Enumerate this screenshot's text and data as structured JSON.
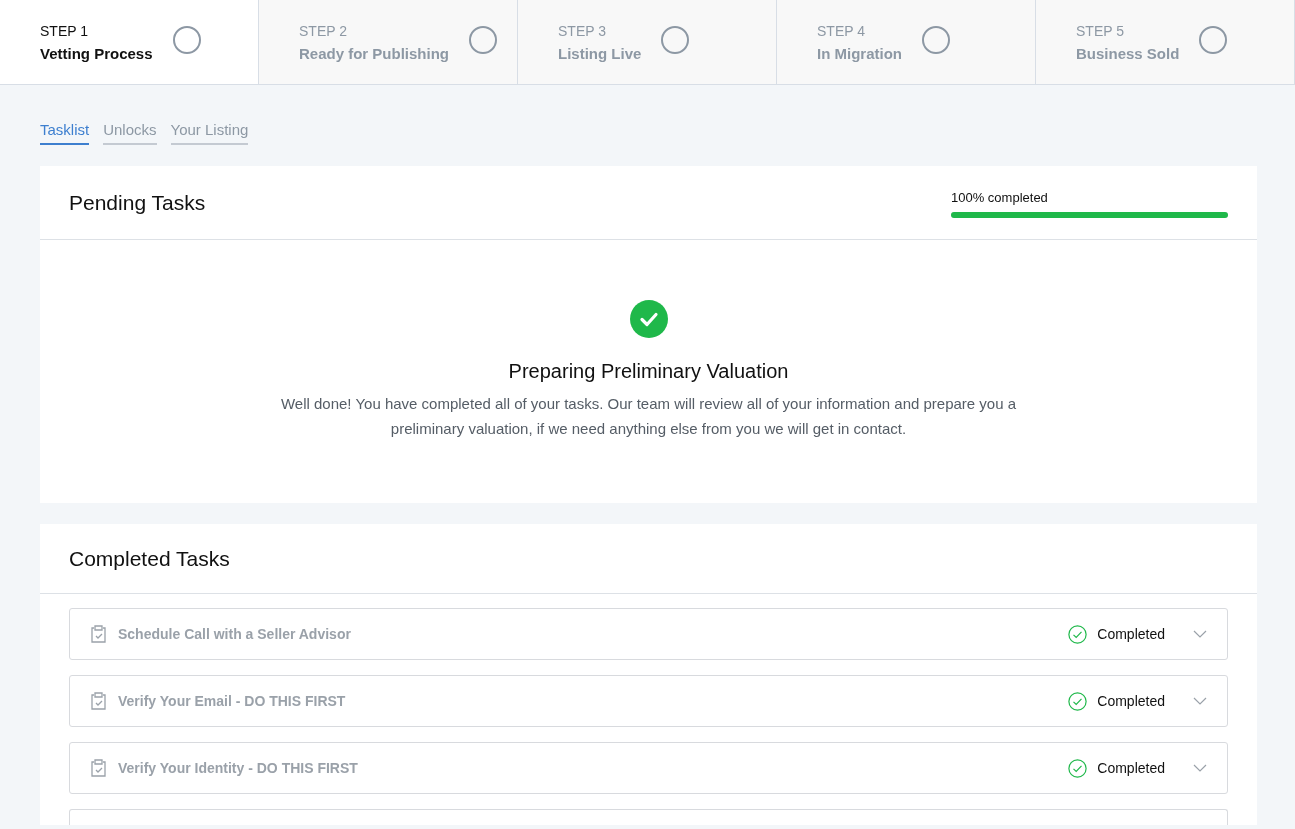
{
  "steps": [
    {
      "number": "STEP 1",
      "label": "Vetting Process",
      "selected": true,
      "done": false
    },
    {
      "number": "STEP 2",
      "label": "Ready for Publishing",
      "selected": false,
      "done": false
    },
    {
      "number": "STEP 3",
      "label": "Listing Live",
      "selected": false,
      "done": false
    },
    {
      "number": "STEP 4",
      "label": "In Migration",
      "selected": false,
      "done": false
    },
    {
      "number": "STEP 5",
      "label": "Business Sold",
      "selected": false,
      "done": false
    }
  ],
  "tabs": [
    {
      "label": "Tasklist",
      "selected": true
    },
    {
      "label": "Unlocks",
      "selected": false
    },
    {
      "label": "Your Listing",
      "selected": false
    }
  ],
  "pending": {
    "title": "Pending Tasks",
    "progress_label": "100% completed",
    "level": 1,
    "done_title": "Preparing Preliminary Valuation",
    "done_text": "Well done! You have completed all of your tasks. Our team will review all of your information and prepare you a preliminary valuation, if we need anything else from you we will get in contact."
  },
  "completed": {
    "title": "Completed Tasks",
    "tasks": [
      {
        "title": "Schedule Call with a Seller Advisor",
        "status": "Completed",
        "expanded": false
      },
      {
        "title": "Verify Your Email - DO THIS FIRST",
        "status": "Completed",
        "expanded": false
      },
      {
        "title": "Verify Your Identity - DO THIS FIRST",
        "status": "Completed",
        "expanded": false
      }
    ]
  }
}
